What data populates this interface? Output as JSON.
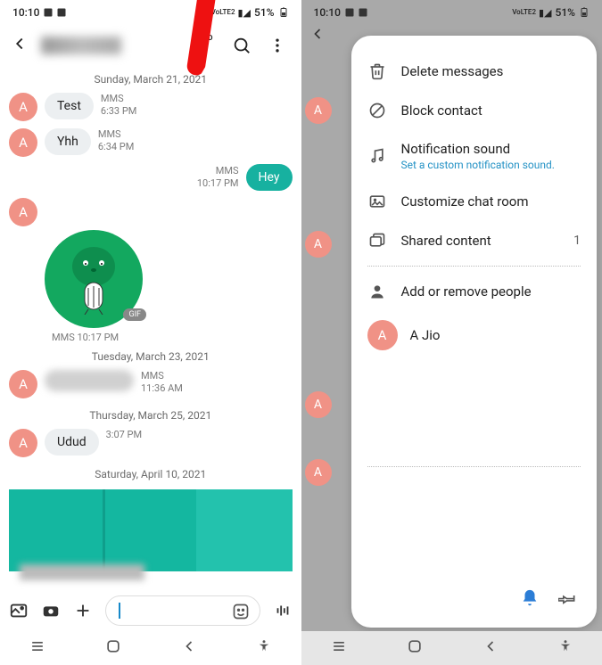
{
  "status": {
    "time": "10:10",
    "battery": "51%",
    "net_label": "VoLTE2",
    "signal_glyph": "▮◢"
  },
  "left": {
    "avatar_letter": "A",
    "dividers": {
      "d1": "Sunday, March 21, 2021",
      "d2": "Tuesday, March 23, 2021",
      "d3": "Thursday, March 25, 2021",
      "d4": "Saturday, April 10, 2021"
    },
    "messages": {
      "m1": {
        "text": "Test",
        "type": "MMS",
        "time": "6:33 PM"
      },
      "m2": {
        "text": "Yhh",
        "type": "MMS",
        "time": "6:34 PM"
      },
      "m3": {
        "text": "Hey",
        "type": "MMS",
        "time": "10:17 PM"
      },
      "m4_gif_caption": "MMS 10:17 PM",
      "m5": {
        "type": "MMS",
        "time": "11:36 AM"
      },
      "m6": {
        "text": "Udud",
        "time": "3:07 PM"
      }
    },
    "gif_badge": "GIF"
  },
  "right": {
    "menu": {
      "delete": "Delete messages",
      "block": "Block contact",
      "notif": "Notification sound",
      "notif_sub": "Set a custom notification sound.",
      "customize": "Customize chat room",
      "shared": "Shared content",
      "shared_count": "1",
      "people": "Add or remove people",
      "contact_name": "A Jio",
      "contact_letter": "A"
    }
  }
}
